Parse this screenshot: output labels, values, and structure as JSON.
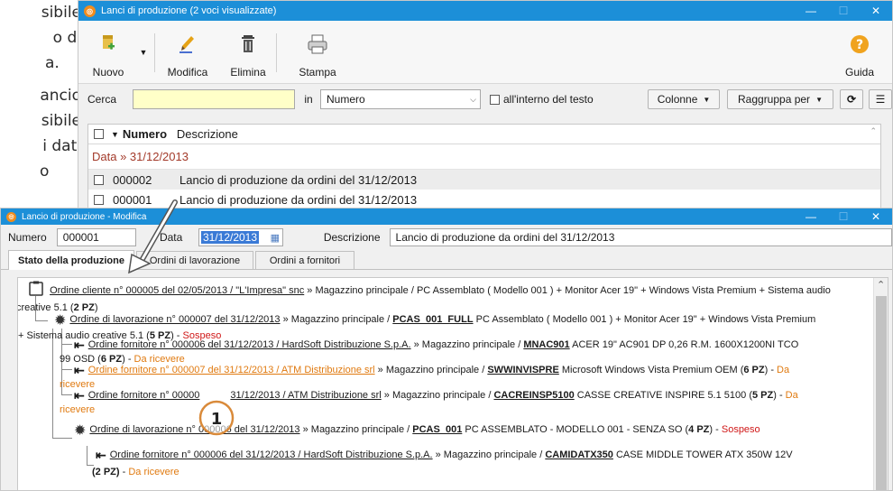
{
  "bg_text": [
    "sibile",
    "o di",
    "a.",
    "ancio",
    "sibile",
    "i dati",
    "o"
  ],
  "win1": {
    "title": "Lanci di produzione (2 voci visualizzate)",
    "toolbar": {
      "new": "Nuovo",
      "edit": "Modifica",
      "delete": "Elimina",
      "print": "Stampa",
      "help": "Guida"
    },
    "search": {
      "label": "Cerca",
      "value": "",
      "in_label": "in",
      "field": "Numero",
      "inside_text": "all'interno del testo",
      "columns": "Colonne",
      "group_by": "Raggruppa per"
    },
    "list": {
      "col_number": "Numero",
      "col_desc": "Descrizione",
      "group": "Data » 31/12/2013",
      "rows": [
        {
          "number": "000002",
          "desc": "Lancio di produzione da ordini del 31/12/2013"
        },
        {
          "number": "000001",
          "desc": "Lancio di produzione da ordini del 31/12/2013"
        }
      ]
    }
  },
  "win2": {
    "title": "Lancio di produzione - Modifica",
    "number_label": "Numero",
    "number": "000001",
    "date_label": "Data",
    "date": "31/12/2013",
    "desc_label": "Descrizione",
    "desc": "Lancio di produzione da ordini del 31/12/2013",
    "tabs": [
      "Stato della produzione",
      "Ordini di lavorazione",
      "Ordini a fornitori"
    ],
    "callout": "1",
    "tree": {
      "n1": {
        "link": "Ordine cliente n° 000005 del 02/05/2013 / \"L'Impresa\" snc",
        "text1": " » Magazzino principale / PC Assemblato ( Modello 001 ) + Monitor Acer 19\" + Windows Vista Premium + Sistema audio",
        "text2": "creative 5.1 (",
        "qty": "2 PZ",
        "close": ")"
      },
      "n2": {
        "link": "Ordine di lavorazione n° 000007 del 31/12/2013",
        "text1": " » Magazzino principale / ",
        "code": "PCAS_001_FULL",
        "text2": " PC Assemblato ( Modello 001 ) + Monitor Acer 19\" + Windows Vista Premium",
        "text3": "+ Sistema audio creative 5.1 (",
        "qty": "5 PZ",
        "close": ") - ",
        "status": "Sospeso"
      },
      "n3": {
        "link": "Ordine fornitore n° 000006 del 31/12/2013 / HardSoft Distribuzione S.p.A.",
        "text1": " » Magazzino principale / ",
        "code": "MNAC901",
        "text2": " ACER 19\" AC901 DP 0,26 R.M. 1600X1200NI TCO",
        "text3": "99 OSD (",
        "qty": "6 PZ",
        "close": ") - ",
        "status": "Da ricevere"
      },
      "n4": {
        "link": "Ordine fornitore n° 000007 del 31/12/2013 / ATM Distribuzione srl",
        "text1": " » Magazzino principale / ",
        "code": "SWWINVISPRE",
        "text2": " Microsoft Windows Vista Premium OEM (",
        "qty": "6 PZ",
        "close": ") - ",
        "status1": "Da",
        "status2": "ricevere"
      },
      "n5": {
        "link": "Ordine fornitore n° 00000",
        "link_b": "31/12/2013 / ATM Distribuzione srl",
        "text1": " » Magazzino principale / ",
        "code": "CACREINSP5100",
        "text2": " CASSE CREATIVE INSPIRE 5.1 5100 (",
        "qty": "5 PZ",
        "close": ") - ",
        "status1": "Da",
        "status2": "ricevere"
      },
      "n6": {
        "link": "Ordine di lavorazione n° 000006 del 31/12/2013",
        "text1": " » Magazzino principale / ",
        "code": "PCAS_001",
        "text2": " PC ASSEMBLATO - MODELLO 001 - SENZA SO (",
        "qty": "4 PZ",
        "close": ") - ",
        "status": "Sospeso"
      },
      "n7": {
        "link": "Ordine fornitore n° 000006 del 31/12/2013 / HardSoft Distribuzione S.p.A.",
        "text1": " » Magazzino principale / ",
        "code": "CAMIDATX350",
        "text2": " CASE MIDDLE TOWER ATX 350W 12V"
      },
      "n8": {
        "cut1": "(2 PZ)",
        "cut2": "Da ricevere"
      }
    }
  },
  "colors": {
    "titlebar": "#1c8fd8",
    "orange": "#e07a10",
    "red": "#d01818",
    "logo": "#f08c1d"
  }
}
